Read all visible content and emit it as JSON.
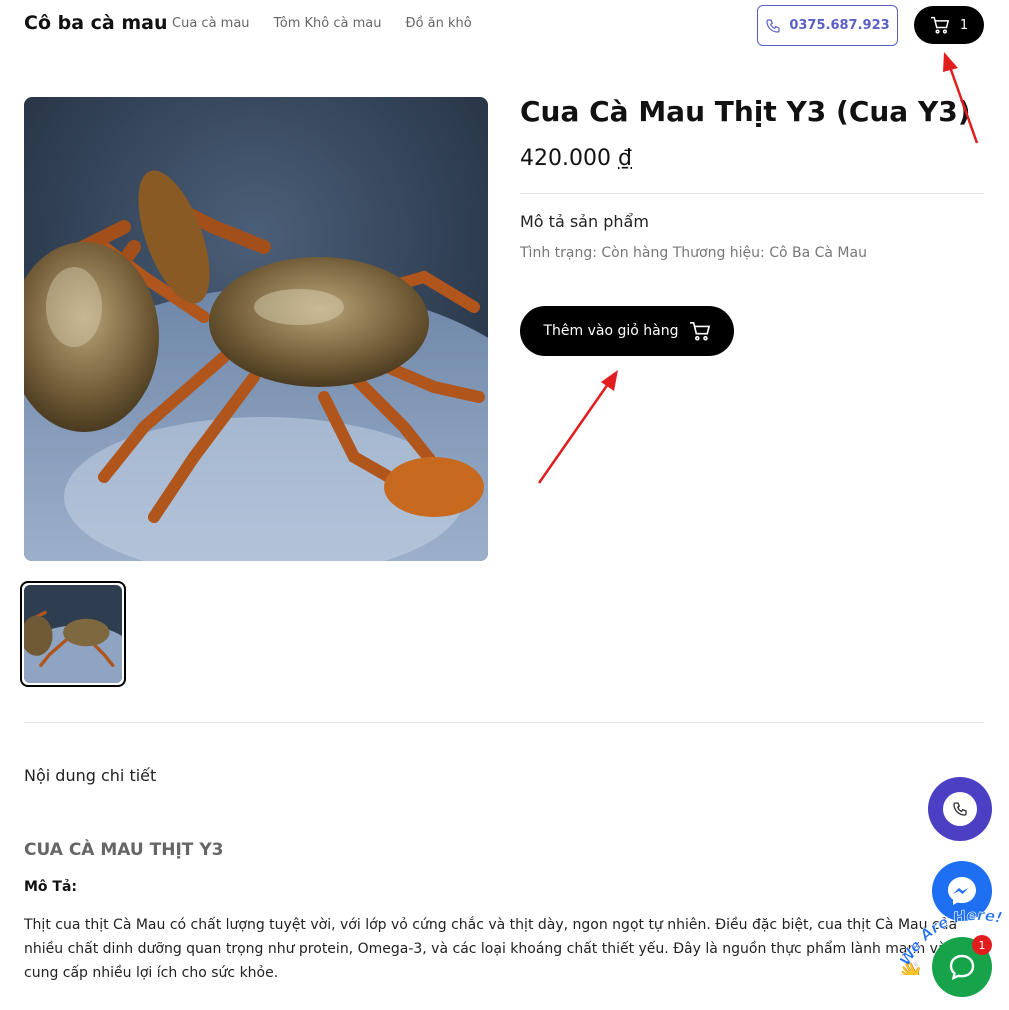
{
  "header": {
    "brand": "Cô ba cà mau",
    "nav": [
      "Cua cà mau",
      "Tôm Khô cà mau",
      "Đồ ăn khô"
    ],
    "phone": "0375.687.923",
    "cart_count": "1"
  },
  "product": {
    "title": "Cua Cà Mau Thịt Y3 (Cua Y3)",
    "price": "420.000",
    "currency": "₫",
    "desc_heading": "Mô tả sản phẩm",
    "status_line": "Tình trạng: Còn hàng Thương hiệu: Cô Ba Cà Mau",
    "add_to_cart": "Thêm vào giỏ hàng"
  },
  "details": {
    "heading": "Nội dung chi tiết",
    "section_title": "CUA CÀ MAU THỊT Y3",
    "mota_label": "Mô Tả:",
    "body": "Thịt cua thịt Cà Mau có chất lượng tuyệt vời, với lớp vỏ cứng chắc và thịt dày, ngon ngọt tự nhiên. Điều đặc biệt, cua thịt Cà Mau của nhiều chất dinh dưỡng quan trọng như protein, Omega-3, và các loại khoáng chất thiết yếu. Đây là nguồn thực phẩm lành mạnh và cung cấp nhiều lợi ích cho sức khỏe."
  },
  "widgets": {
    "chat_badge": "1",
    "we_are_here": "We Are Here!"
  },
  "colors": {
    "accent": "#5b5fc7",
    "call": "#4b3fc4",
    "messenger": "#1e6ff2",
    "chat": "#17a34a",
    "arrow": "#e11d1d"
  }
}
